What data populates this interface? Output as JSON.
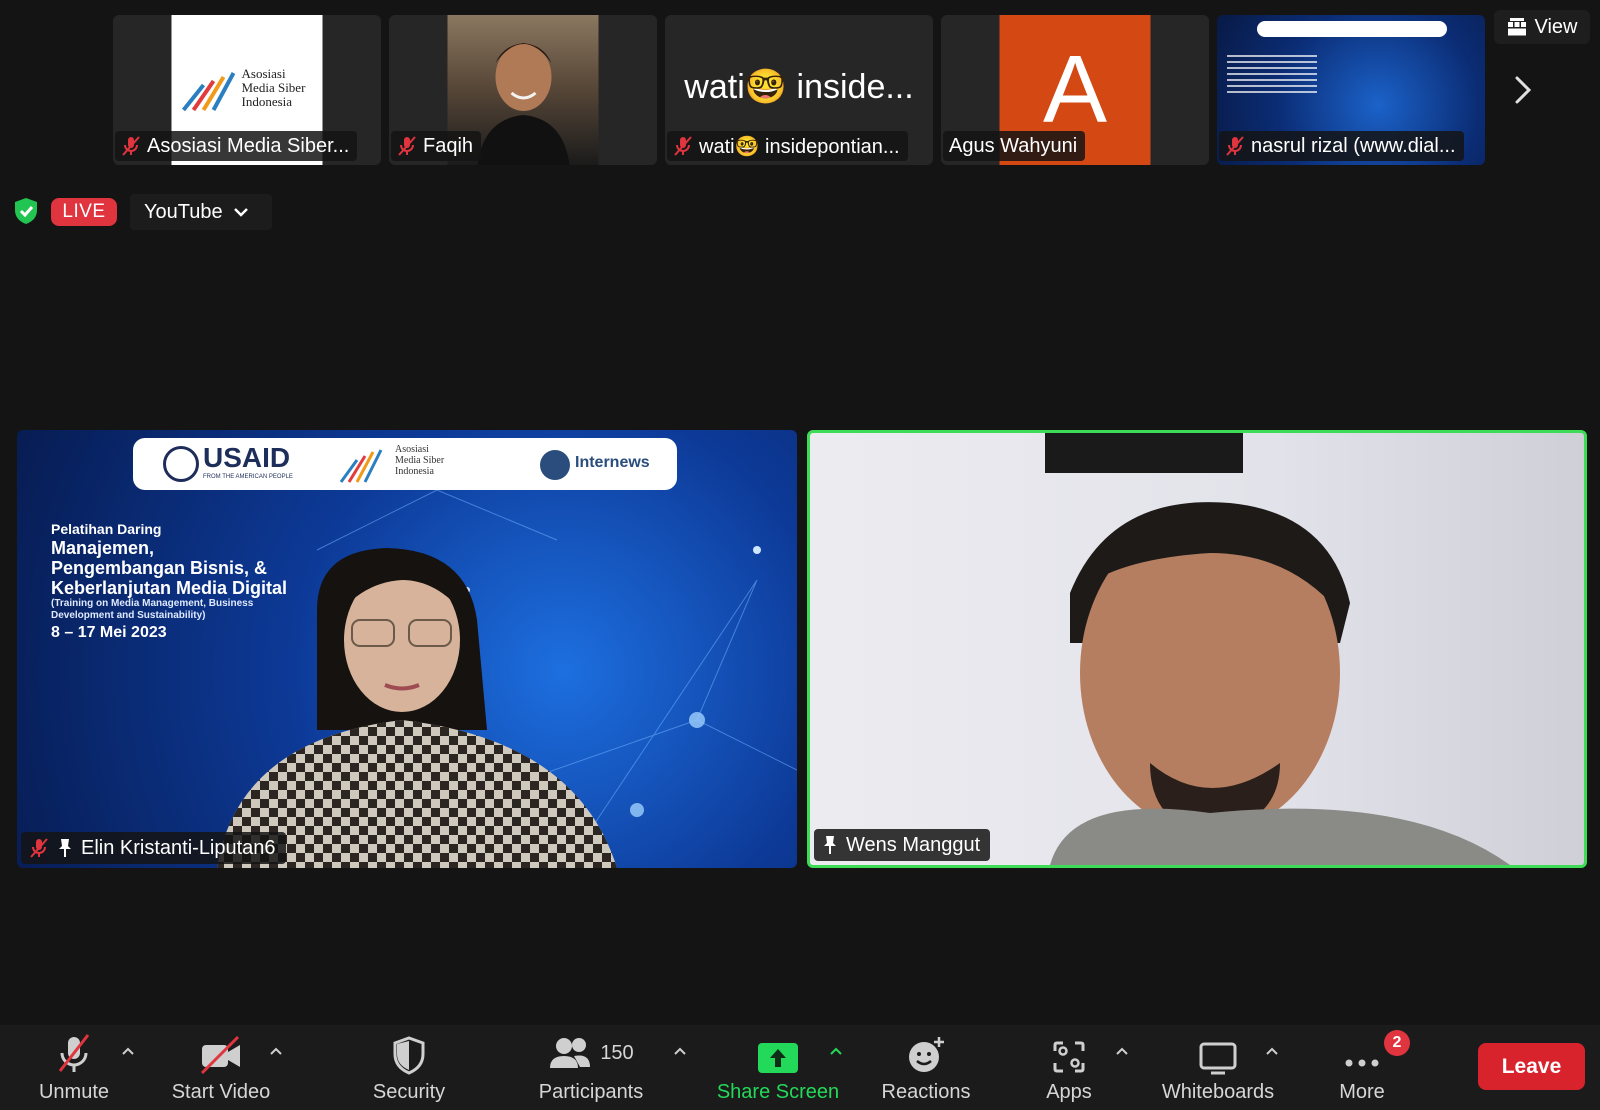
{
  "participants_strip": [
    {
      "name": "Asosiasi Media Siber...",
      "muted": true,
      "logo_text": [
        "Asosiasi",
        "Media Siber",
        "Indonesia"
      ]
    },
    {
      "name": "Faqih",
      "muted": true
    },
    {
      "name": "wati🤓 insidepontian...",
      "muted": true,
      "tile_text": "wati🤓 inside..."
    },
    {
      "name": "Agus Wahyuni",
      "muted": false,
      "avatar_letter": "A"
    },
    {
      "name": "nasrul rizal (www.dial...",
      "muted": true
    }
  ],
  "view_button": {
    "label": "View"
  },
  "live_bar": {
    "live_label": "LIVE",
    "platform": "YouTube"
  },
  "main_tiles": [
    {
      "name": "Elin Kristanti-Liputan6",
      "muted": true,
      "pinned": true,
      "slide": {
        "logo_usaid": "USAID",
        "logo_usaid_sub": "FROM THE AMERICAN PEOPLE",
        "logo_amsi": [
          "Asosiasi",
          "Media Siber",
          "Indonesia"
        ],
        "logo_internews": "Internews",
        "kicker": "Pelatihan Daring",
        "title_lines": [
          "Manajemen,",
          "Pengembangan Bisnis, &",
          "Keberlanjutan Media Digital"
        ],
        "subtitle_lines": [
          "(Training on Media Management, Business",
          "Development and Sustainability)"
        ],
        "dates": "8 – 17 Mei 2023"
      }
    },
    {
      "name": "Wens Manggut",
      "muted": false,
      "pinned": true,
      "active_speaker": true
    }
  ],
  "toolbar": {
    "unmute": "Unmute",
    "start_video": "Start Video",
    "security": "Security",
    "participants": "Participants",
    "participants_count": "150",
    "share_screen": "Share Screen",
    "reactions": "Reactions",
    "apps": "Apps",
    "whiteboards": "Whiteboards",
    "more": "More",
    "more_badge": "2",
    "leave": "Leave"
  },
  "colors": {
    "share_green": "#23d959",
    "live_red": "#e0343f",
    "leave_red": "#d8232d",
    "speaker_border": "#3ddc57",
    "agus_avatar_bg": "#d44813"
  }
}
